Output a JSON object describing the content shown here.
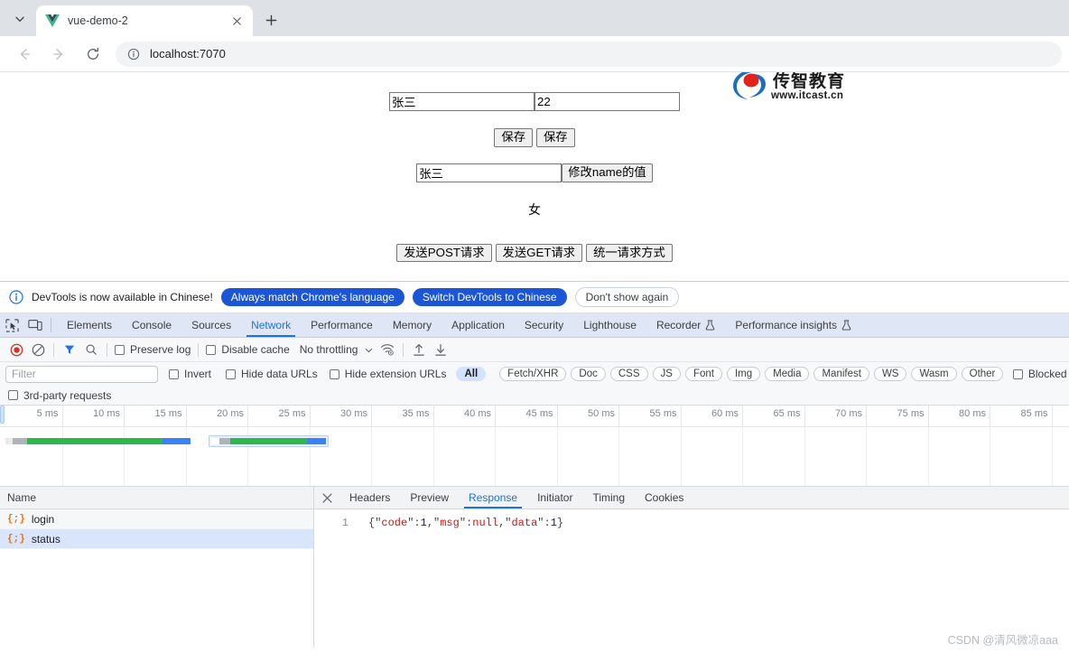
{
  "browser": {
    "tab": {
      "title": "vue-demo-2",
      "favicon": "vue-logo-icon",
      "close": "×"
    },
    "new_tab_label": "+",
    "tab_list_caret": "⌄",
    "nav": {
      "back": "←",
      "forward": "→",
      "reload": "⟳"
    },
    "omnibox": {
      "url": "localhost:7070",
      "site_icon": "info-circle-icon"
    }
  },
  "page": {
    "logo": {
      "cn": "传智教育",
      "url": "www.itcast.cn"
    },
    "name_input": "张三",
    "age_input": "22",
    "save_button_1": "保存",
    "save_button_2": "保存",
    "name_input_2": "张三",
    "modify_name_button": "修改name的值",
    "gender_text": "女",
    "post_button": "发送POST请求",
    "get_button": "发送GET请求",
    "unified_button": "统一请求方式"
  },
  "devtools": {
    "banner": {
      "message": "DevTools is now available in Chinese!",
      "btn_always_match": "Always match Chrome's language",
      "btn_switch": "Switch DevTools to Chinese",
      "btn_dismiss": "Don't show again"
    },
    "tabs": [
      {
        "label": "Elements",
        "active": false
      },
      {
        "label": "Console",
        "active": false
      },
      {
        "label": "Sources",
        "active": false
      },
      {
        "label": "Network",
        "active": true
      },
      {
        "label": "Performance",
        "active": false
      },
      {
        "label": "Memory",
        "active": false
      },
      {
        "label": "Application",
        "active": false
      },
      {
        "label": "Security",
        "active": false
      },
      {
        "label": "Lighthouse",
        "active": false
      },
      {
        "label": "Recorder",
        "active": false,
        "flask": true
      },
      {
        "label": "Performance insights",
        "active": false,
        "flask": true
      }
    ],
    "toolbar": {
      "record_icon": "record-button-icon",
      "clear_icon": "clear-icon",
      "filter_icon": "filter-icon",
      "search_icon": "search-icon",
      "preserve_log": "Preserve log",
      "disable_cache": "Disable cache",
      "throttling": "No throttling",
      "caret": "▼",
      "wifi_icon": "network-conditions-icon",
      "import_icon": "import-har-icon",
      "export_icon": "export-har-icon"
    },
    "filterbar": {
      "placeholder": "Filter",
      "invert": "Invert",
      "hide_data_urls": "Hide data URLs",
      "hide_extension_urls": "Hide extension URLs",
      "types": [
        "All",
        "Fetch/XHR",
        "Doc",
        "CSS",
        "JS",
        "Font",
        "Img",
        "Media",
        "Manifest",
        "WS",
        "Wasm",
        "Other"
      ],
      "selected_type": "All",
      "blocked_response": "Blocked response c",
      "third_party": "3rd-party requests"
    },
    "overview": {
      "ticks": [
        "5 ms",
        "10 ms",
        "15 ms",
        "20 ms",
        "25 ms",
        "30 ms",
        "35 ms",
        "40 ms",
        "45 ms",
        "50 ms",
        "55 ms",
        "60 ms",
        "65 ms",
        "70 ms",
        "75 ms",
        "80 ms",
        "85 ms"
      ]
    },
    "requests": {
      "column_header": "Name",
      "rows": [
        {
          "name": "login",
          "icon": "json-icon",
          "selected": false
        },
        {
          "name": "status",
          "icon": "json-icon",
          "selected": true
        }
      ]
    },
    "detail": {
      "close": "✕",
      "tabs": [
        {
          "label": "Headers",
          "active": false
        },
        {
          "label": "Preview",
          "active": false
        },
        {
          "label": "Response",
          "active": true
        },
        {
          "label": "Initiator",
          "active": false
        },
        {
          "label": "Timing",
          "active": false
        },
        {
          "label": "Cookies",
          "active": false
        }
      ],
      "response": {
        "line_number": "1",
        "tokens": [
          {
            "t": "{\"",
            "c": "punct"
          },
          {
            "t": "code",
            "c": "key"
          },
          {
            "t": "\":",
            "c": "punct"
          },
          {
            "t": "1",
            "c": "num"
          },
          {
            "t": ",\"",
            "c": "punct"
          },
          {
            "t": "msg",
            "c": "key"
          },
          {
            "t": "\":",
            "c": "punct"
          },
          {
            "t": "null",
            "c": "null"
          },
          {
            "t": ",\"",
            "c": "punct"
          },
          {
            "t": "data",
            "c": "key"
          },
          {
            "t": "\":",
            "c": "punct"
          },
          {
            "t": "1",
            "c": "num"
          },
          {
            "t": "}",
            "c": "punct"
          }
        ]
      }
    }
  },
  "watermark": "CSDN @清风微凉aaa",
  "colors": {
    "accent": "#1a73e8",
    "banner_primary": "#1a56d6",
    "record_red": "#d93025",
    "json_icon": "#e8710a",
    "waterfall_green": "#2db84d",
    "waterfall_blue": "#3b82f6",
    "waterfall_grey": "#b0b3b8",
    "selected_row": "#d8e5fb"
  }
}
